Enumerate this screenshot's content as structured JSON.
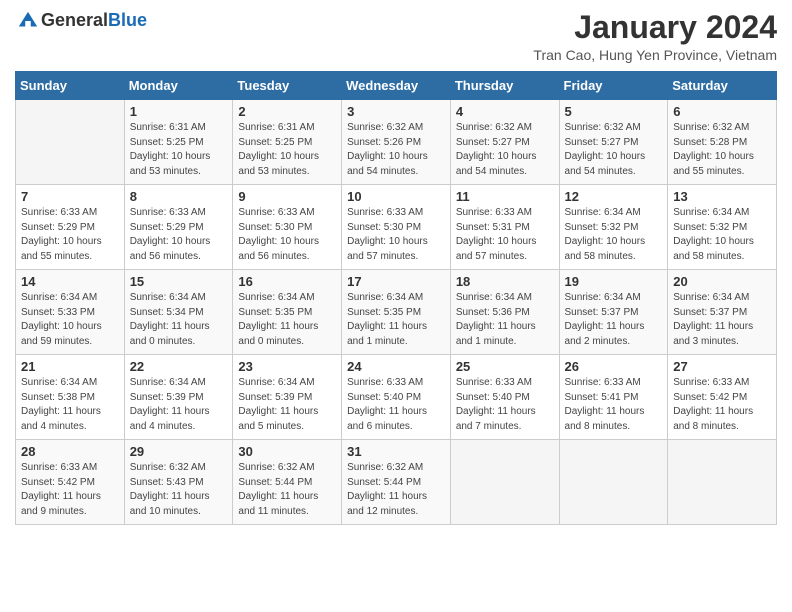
{
  "header": {
    "logo_general": "General",
    "logo_blue": "Blue",
    "month_title": "January 2024",
    "location": "Tran Cao, Hung Yen Province, Vietnam"
  },
  "weekdays": [
    "Sunday",
    "Monday",
    "Tuesday",
    "Wednesday",
    "Thursday",
    "Friday",
    "Saturday"
  ],
  "weeks": [
    [
      {
        "day": "",
        "sunrise": "",
        "sunset": "",
        "daylight": ""
      },
      {
        "day": "1",
        "sunrise": "Sunrise: 6:31 AM",
        "sunset": "Sunset: 5:25 PM",
        "daylight": "Daylight: 10 hours and 53 minutes."
      },
      {
        "day": "2",
        "sunrise": "Sunrise: 6:31 AM",
        "sunset": "Sunset: 5:25 PM",
        "daylight": "Daylight: 10 hours and 53 minutes."
      },
      {
        "day": "3",
        "sunrise": "Sunrise: 6:32 AM",
        "sunset": "Sunset: 5:26 PM",
        "daylight": "Daylight: 10 hours and 54 minutes."
      },
      {
        "day": "4",
        "sunrise": "Sunrise: 6:32 AM",
        "sunset": "Sunset: 5:27 PM",
        "daylight": "Daylight: 10 hours and 54 minutes."
      },
      {
        "day": "5",
        "sunrise": "Sunrise: 6:32 AM",
        "sunset": "Sunset: 5:27 PM",
        "daylight": "Daylight: 10 hours and 54 minutes."
      },
      {
        "day": "6",
        "sunrise": "Sunrise: 6:32 AM",
        "sunset": "Sunset: 5:28 PM",
        "daylight": "Daylight: 10 hours and 55 minutes."
      }
    ],
    [
      {
        "day": "7",
        "sunrise": "Sunrise: 6:33 AM",
        "sunset": "Sunset: 5:29 PM",
        "daylight": "Daylight: 10 hours and 55 minutes."
      },
      {
        "day": "8",
        "sunrise": "Sunrise: 6:33 AM",
        "sunset": "Sunset: 5:29 PM",
        "daylight": "Daylight: 10 hours and 56 minutes."
      },
      {
        "day": "9",
        "sunrise": "Sunrise: 6:33 AM",
        "sunset": "Sunset: 5:30 PM",
        "daylight": "Daylight: 10 hours and 56 minutes."
      },
      {
        "day": "10",
        "sunrise": "Sunrise: 6:33 AM",
        "sunset": "Sunset: 5:30 PM",
        "daylight": "Daylight: 10 hours and 57 minutes."
      },
      {
        "day": "11",
        "sunrise": "Sunrise: 6:33 AM",
        "sunset": "Sunset: 5:31 PM",
        "daylight": "Daylight: 10 hours and 57 minutes."
      },
      {
        "day": "12",
        "sunrise": "Sunrise: 6:34 AM",
        "sunset": "Sunset: 5:32 PM",
        "daylight": "Daylight: 10 hours and 58 minutes."
      },
      {
        "day": "13",
        "sunrise": "Sunrise: 6:34 AM",
        "sunset": "Sunset: 5:32 PM",
        "daylight": "Daylight: 10 hours and 58 minutes."
      }
    ],
    [
      {
        "day": "14",
        "sunrise": "Sunrise: 6:34 AM",
        "sunset": "Sunset: 5:33 PM",
        "daylight": "Daylight: 10 hours and 59 minutes."
      },
      {
        "day": "15",
        "sunrise": "Sunrise: 6:34 AM",
        "sunset": "Sunset: 5:34 PM",
        "daylight": "Daylight: 11 hours and 0 minutes."
      },
      {
        "day": "16",
        "sunrise": "Sunrise: 6:34 AM",
        "sunset": "Sunset: 5:35 PM",
        "daylight": "Daylight: 11 hours and 0 minutes."
      },
      {
        "day": "17",
        "sunrise": "Sunrise: 6:34 AM",
        "sunset": "Sunset: 5:35 PM",
        "daylight": "Daylight: 11 hours and 1 minute."
      },
      {
        "day": "18",
        "sunrise": "Sunrise: 6:34 AM",
        "sunset": "Sunset: 5:36 PM",
        "daylight": "Daylight: 11 hours and 1 minute."
      },
      {
        "day": "19",
        "sunrise": "Sunrise: 6:34 AM",
        "sunset": "Sunset: 5:37 PM",
        "daylight": "Daylight: 11 hours and 2 minutes."
      },
      {
        "day": "20",
        "sunrise": "Sunrise: 6:34 AM",
        "sunset": "Sunset: 5:37 PM",
        "daylight": "Daylight: 11 hours and 3 minutes."
      }
    ],
    [
      {
        "day": "21",
        "sunrise": "Sunrise: 6:34 AM",
        "sunset": "Sunset: 5:38 PM",
        "daylight": "Daylight: 11 hours and 4 minutes."
      },
      {
        "day": "22",
        "sunrise": "Sunrise: 6:34 AM",
        "sunset": "Sunset: 5:39 PM",
        "daylight": "Daylight: 11 hours and 4 minutes."
      },
      {
        "day": "23",
        "sunrise": "Sunrise: 6:34 AM",
        "sunset": "Sunset: 5:39 PM",
        "daylight": "Daylight: 11 hours and 5 minutes."
      },
      {
        "day": "24",
        "sunrise": "Sunrise: 6:33 AM",
        "sunset": "Sunset: 5:40 PM",
        "daylight": "Daylight: 11 hours and 6 minutes."
      },
      {
        "day": "25",
        "sunrise": "Sunrise: 6:33 AM",
        "sunset": "Sunset: 5:40 PM",
        "daylight": "Daylight: 11 hours and 7 minutes."
      },
      {
        "day": "26",
        "sunrise": "Sunrise: 6:33 AM",
        "sunset": "Sunset: 5:41 PM",
        "daylight": "Daylight: 11 hours and 8 minutes."
      },
      {
        "day": "27",
        "sunrise": "Sunrise: 6:33 AM",
        "sunset": "Sunset: 5:42 PM",
        "daylight": "Daylight: 11 hours and 8 minutes."
      }
    ],
    [
      {
        "day": "28",
        "sunrise": "Sunrise: 6:33 AM",
        "sunset": "Sunset: 5:42 PM",
        "daylight": "Daylight: 11 hours and 9 minutes."
      },
      {
        "day": "29",
        "sunrise": "Sunrise: 6:32 AM",
        "sunset": "Sunset: 5:43 PM",
        "daylight": "Daylight: 11 hours and 10 minutes."
      },
      {
        "day": "30",
        "sunrise": "Sunrise: 6:32 AM",
        "sunset": "Sunset: 5:44 PM",
        "daylight": "Daylight: 11 hours and 11 minutes."
      },
      {
        "day": "31",
        "sunrise": "Sunrise: 6:32 AM",
        "sunset": "Sunset: 5:44 PM",
        "daylight": "Daylight: 11 hours and 12 minutes."
      },
      {
        "day": "",
        "sunrise": "",
        "sunset": "",
        "daylight": ""
      },
      {
        "day": "",
        "sunrise": "",
        "sunset": "",
        "daylight": ""
      },
      {
        "day": "",
        "sunrise": "",
        "sunset": "",
        "daylight": ""
      }
    ]
  ]
}
